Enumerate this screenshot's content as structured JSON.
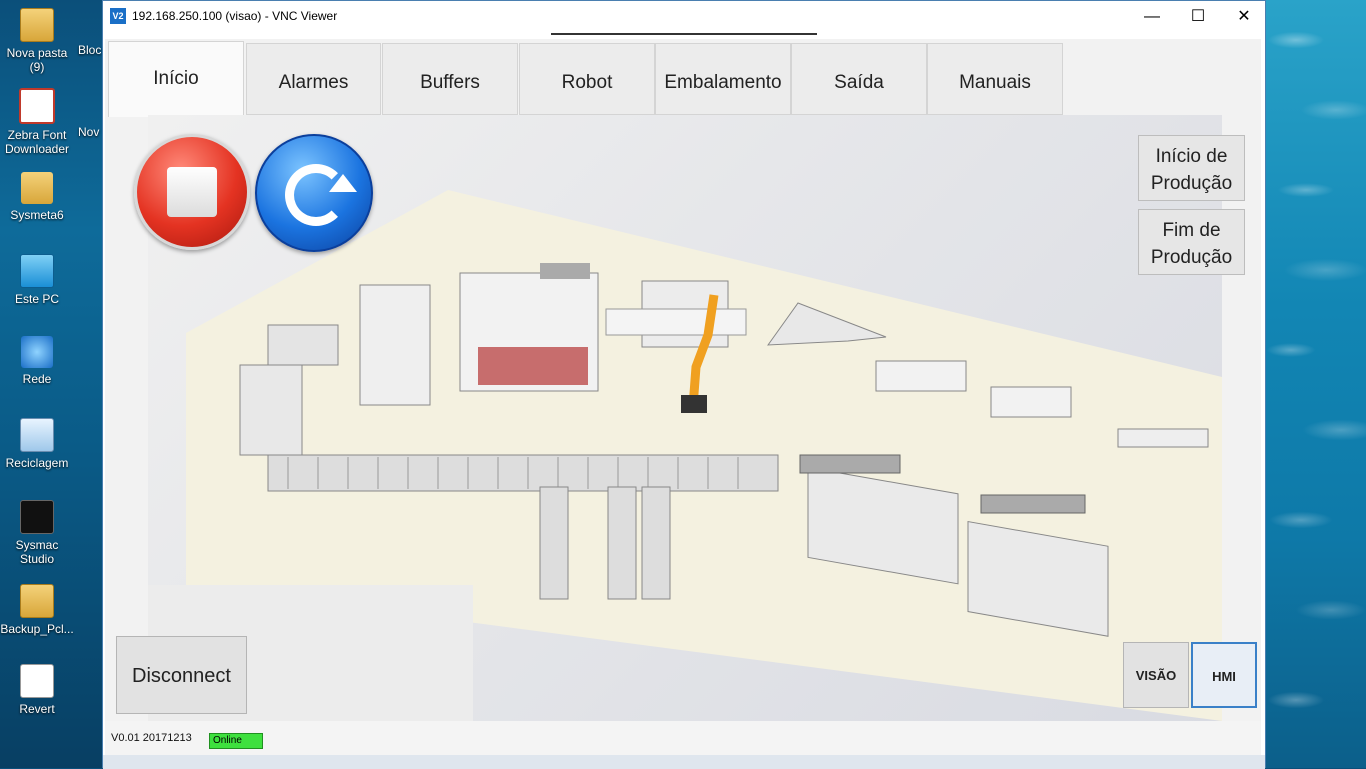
{
  "desktop": {
    "icons": [
      {
        "label": "Nova pasta\n(9)",
        "icon": "folder-icon"
      },
      {
        "label": "Zebra Font\nDownloader",
        "icon": "font-app-icon"
      },
      {
        "label": "Sysmeta6",
        "icon": "user-folder-icon"
      },
      {
        "label": "Este PC",
        "icon": "computer-icon"
      },
      {
        "label": "Rede",
        "icon": "network-icon"
      },
      {
        "label": "Reciclagem",
        "icon": "recycle-bin-icon"
      },
      {
        "label": "Sysmac\nStudio",
        "icon": "sysmac-icon"
      },
      {
        "label": "Backup_Pcl...",
        "icon": "folder-icon"
      },
      {
        "label": "Revert",
        "icon": "document-icon"
      }
    ],
    "partial_labels": [
      "Bloc",
      "Nov"
    ]
  },
  "window": {
    "app_icon_text": "V2",
    "title": "192.168.250.100 (visao) - VNC Viewer",
    "minimize": "—",
    "maximize": "☐",
    "close": "✕"
  },
  "hmi": {
    "tabs": [
      {
        "label": "Início",
        "active": true
      },
      {
        "label": "Alarmes",
        "active": false
      },
      {
        "label": "Buffers",
        "active": false
      },
      {
        "label": "Robot",
        "active": false
      },
      {
        "label": "Embalamento",
        "active": false
      },
      {
        "label": "Saída",
        "active": false
      },
      {
        "label": "Manuais",
        "active": false
      }
    ],
    "side_buttons": {
      "start_production": "Início de\nProdução",
      "end_production": "Fim de\nProdução"
    },
    "disconnect": "Disconnect",
    "mode_buttons": {
      "visao": "VISÃO",
      "hmi": "HMI",
      "active": "HMI"
    },
    "status": {
      "version": "V0.01 20171213",
      "connection": "Online",
      "connection_color": "#3ee03e"
    },
    "colors": {
      "stop": "#e43322",
      "reset": "#1b74e0",
      "robot": "#f0a020"
    }
  }
}
